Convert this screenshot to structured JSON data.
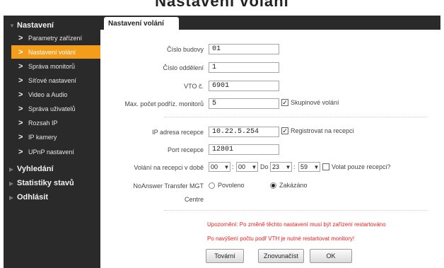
{
  "top_heading": "Nastavení volání",
  "sidebar": {
    "sections": [
      {
        "label": "Nastavení"
      },
      {
        "label": "Vyhledání"
      },
      {
        "label": "Statistiky stavů"
      },
      {
        "label": "Odhlásit"
      }
    ],
    "items": [
      {
        "label": "Parametry zařízení"
      },
      {
        "label": "Nastavení volání"
      },
      {
        "label": "Správa monitorů"
      },
      {
        "label": "Síťové nastavení"
      },
      {
        "label": "Video a Audio"
      },
      {
        "label": "Správa uživatelů"
      },
      {
        "label": "Rozsah IP"
      },
      {
        "label": "IP kamery"
      },
      {
        "label": "UPnP nastavení"
      }
    ],
    "active_item": "Nastavení volání"
  },
  "tab": {
    "label": "Nastavení volání"
  },
  "form": {
    "building_no": {
      "label": "Číslo budovy",
      "value": "01"
    },
    "unit_no": {
      "label": "Číslo oddělení",
      "value": "1"
    },
    "vto_no": {
      "label": "VTO č.",
      "value": "6901"
    },
    "max_monitors": {
      "label": "Max. počet podříz. monitorů",
      "value": "5"
    },
    "group_call": {
      "label": "Skupinové volání",
      "checked": true
    },
    "reception_ip": {
      "label": "IP adresa recepce",
      "value": "10.22.5.254"
    },
    "register_reception": {
      "label": "Registrovat na recepci",
      "checked": true
    },
    "reception_port": {
      "label": "Port recepce",
      "value": "12801"
    },
    "reception_time": {
      "label": "Volání na recepci v době",
      "from_h": "00",
      "from_m": "00",
      "to_label": "Do",
      "to_h": "23",
      "to_m": "59",
      "sep": ":"
    },
    "reception_only": {
      "label": "Volat pouze recepci?",
      "checked": false
    },
    "noanswer": {
      "label_line1": "NoAnswer Transfer MGT",
      "label_line2": "Centre",
      "option_enabled": "Povoleno",
      "option_disabled": "Zakázáno",
      "selected": "Zakázáno"
    }
  },
  "warnings": [
    "Upozornění: Po změně těchto nastavení musí být zařízení restartováno",
    "Po navýšení počtu podř VTH je nutné restartovat monitory!"
  ],
  "buttons": {
    "default": "Tovární",
    "refresh": "Znovunačíst",
    "ok": "OK"
  },
  "colors": {
    "sidebar_bg": "#2a2a2a",
    "active_item": "#f49d1a",
    "warning": "#e22222"
  }
}
